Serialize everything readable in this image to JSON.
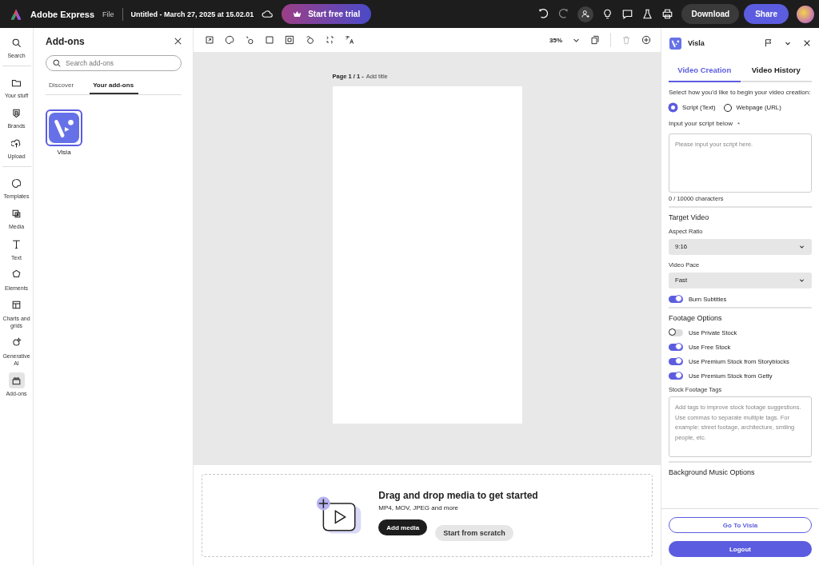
{
  "topbar": {
    "app_name": "Adobe Express",
    "file_menu": "File",
    "doc_title": "Untitled - March 27, 2025 at 15.02.01",
    "trial_button": "Start free trial",
    "download_button": "Download",
    "share_button": "Share"
  },
  "rail": {
    "groups": [
      [
        {
          "label": "Search",
          "selected": false
        }
      ],
      [
        {
          "label": "Your stuff",
          "selected": false
        },
        {
          "label": "Brands",
          "selected": false
        },
        {
          "label": "Upload",
          "selected": false
        }
      ],
      [
        {
          "label": "Templates",
          "selected": false
        },
        {
          "label": "Media",
          "selected": false
        },
        {
          "label": "Text",
          "selected": false
        },
        {
          "label": "Elements",
          "selected": false
        },
        {
          "label": "Charts and grids",
          "selected": false
        },
        {
          "label": "Generative AI",
          "selected": false
        },
        {
          "label": "Add-ons",
          "selected": true
        }
      ]
    ]
  },
  "addons_panel": {
    "title": "Add-ons",
    "search": {
      "placeholder": "Search add-ons"
    },
    "tabs": [
      {
        "label": "Discover",
        "selected": false
      },
      {
        "label": "Your add-ons",
        "selected": true
      }
    ],
    "addons": [
      {
        "name": "Visla",
        "selected": true
      }
    ]
  },
  "toolbar": {
    "zoom": "35%"
  },
  "page": {
    "label": "Page 1 / 1 -",
    "title_placeholder": "Add title"
  },
  "dropzone": {
    "heading": "Drag and drop media to get started",
    "formats": "MP4, MOV, JPEG and more",
    "buttons": [
      {
        "label": "Add media",
        "kind": "primary"
      },
      {
        "label": "Start from scratch",
        "kind": "secondary"
      }
    ]
  },
  "visla": {
    "title": "Visla",
    "tabs": [
      {
        "label": "Video Creation",
        "selected": true
      },
      {
        "label": "Video History",
        "selected": false
      }
    ],
    "prompt": "Select how you’d like to begin your video creation:",
    "sources": [
      {
        "label": "Script (Text)",
        "selected": true
      },
      {
        "label": "Webpage (URL)",
        "selected": false
      }
    ],
    "script_label": "Input your script below",
    "required_mark": "*",
    "script_placeholder": "Please input your script here.",
    "char_count": "0 / 10000 characters",
    "target_heading": "Target Video",
    "aspect_label": "Aspect Ratio",
    "aspect_value": "9:16",
    "pace_label": "Video Pace",
    "pace_value": "Fast",
    "subtitles": {
      "label": "Burn Subtitles",
      "on": true
    },
    "footage_heading": "Footage Options",
    "footage_toggles": [
      {
        "label": "Use Private Stock",
        "on": false
      },
      {
        "label": "Use Free Stock",
        "on": true
      },
      {
        "label": "Use Premium Stock from Storyblocks",
        "on": true
      },
      {
        "label": "Use Premium Stock from Getty",
        "on": true
      }
    ],
    "tags_label": "Stock Footage Tags",
    "tags_placeholder": "Add tags to improve stock footage suggestions. Use commas to separate multiple tags. For example: street footage, architecture, smiling people, etc.",
    "music_heading": "Background Music Options",
    "go_button": "Go To Visla",
    "logout_button": "Logout"
  }
}
